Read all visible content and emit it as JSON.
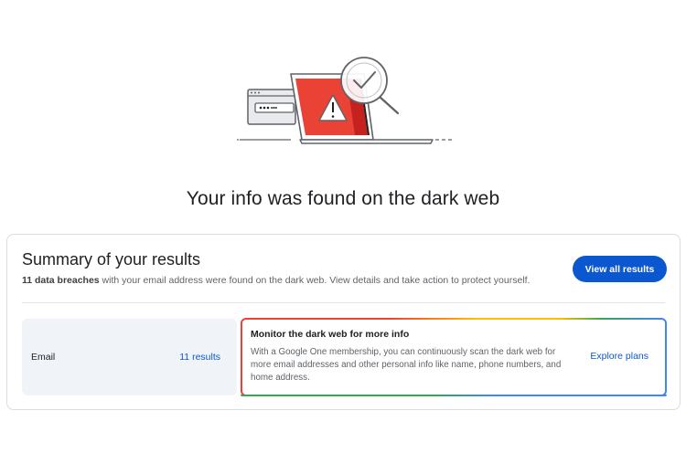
{
  "headline": "Your info was found on the dark web",
  "summary": {
    "title": "Summary of your results",
    "breach_count": "11 data breaches",
    "description_rest": " with your email address were found on the dark web. View details and take action to protect yourself.",
    "view_all_label": "View all results"
  },
  "email_row": {
    "label": "Email",
    "results_link": "11 results"
  },
  "promo": {
    "title": "Monitor the dark web for more info",
    "body": "With a Google One membership, you can continuously scan the dark web for more email addresses and other personal info like name, phone numbers, and home address.",
    "link": "Explore plans"
  },
  "colors": {
    "primary": "#0b57d0",
    "alert_red": "#ea4335",
    "google_yellow": "#fbbc04",
    "google_green": "#34a853",
    "google_blue": "#4285f4"
  },
  "icons": [
    "laptop-warning-illustration",
    "magnifier-check-icon",
    "password-window-icon",
    "warning-triangle-icon"
  ]
}
